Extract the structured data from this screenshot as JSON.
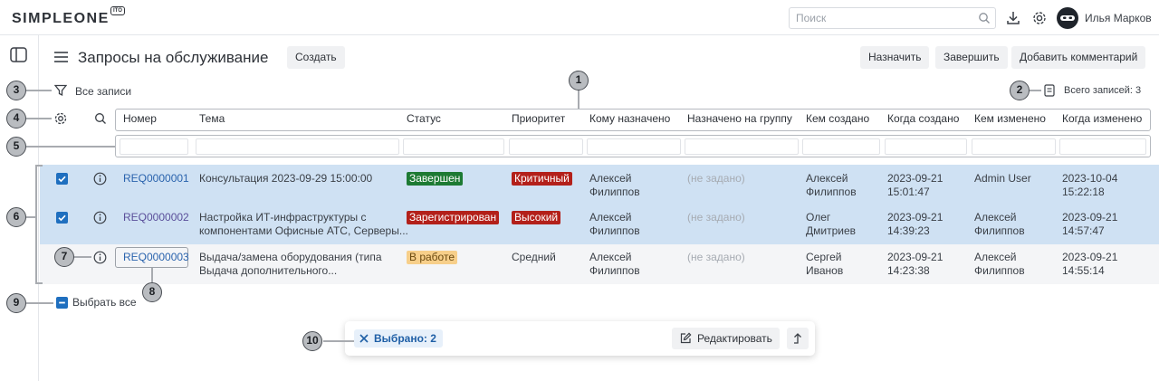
{
  "app": {
    "logo": "SIMPLEONE",
    "logo_badge": "ITO"
  },
  "topbar": {
    "search_placeholder": "Поиск",
    "user_name": "Илья Марков"
  },
  "page": {
    "title": "Запросы на обслуживание",
    "create_label": "Создать"
  },
  "actions": {
    "assign": "Назначить",
    "complete": "Завершить",
    "add_comment": "Добавить комментарий"
  },
  "filter": {
    "label": "Все записи"
  },
  "total": {
    "label": "Всего записей: 3"
  },
  "columns": [
    "Номер",
    "Тема",
    "Статус",
    "Приоритет",
    "Кому назначено",
    "Назначено на группу",
    "Кем создано",
    "Когда создано",
    "Кем изменено",
    "Когда изменено"
  ],
  "rows": [
    {
      "number": "REQ0000001",
      "subject_1": "Консультация 2023-09-29 15:00:00",
      "subject_2": "",
      "status": "Завершен",
      "priority": "Критичный",
      "assignee_1": "Алексей",
      "assignee_2": "Филиппов",
      "group": "(не задано)",
      "created_by_1": "Алексей",
      "created_by_2": "Филиппов",
      "created_date": "2023-09-21",
      "created_time": "15:01:47",
      "updated_by_1": "Admin User",
      "updated_by_2": "",
      "updated_date": "2023-10-04",
      "updated_time": "15:22:18"
    },
    {
      "number": "REQ0000002",
      "subject_1": "Настройка ИТ-инфраструктуры с",
      "subject_2": "компонентами Офисные АТС, Серверы...",
      "status": "Зарегистрирован",
      "priority": "Высокий",
      "assignee_1": "Алексей",
      "assignee_2": "Филиппов",
      "group": "(не задано)",
      "created_by_1": "Олег",
      "created_by_2": "Дмитриев",
      "created_date": "2023-09-21",
      "created_time": "14:39:23",
      "updated_by_1": "Алексей",
      "updated_by_2": "Филиппов",
      "updated_date": "2023-09-21",
      "updated_time": "14:57:47"
    },
    {
      "number": "REQ0000003",
      "subject_1": "Выдача/замена оборудования (типа",
      "subject_2": "Выдача дополнительного...",
      "status": "В работе",
      "priority": "Средний",
      "assignee_1": "Алексей",
      "assignee_2": "Филиппов",
      "group": "(не задано)",
      "created_by_1": "Сергей",
      "created_by_2": "Иванов",
      "created_date": "2023-09-21",
      "created_time": "14:23:38",
      "updated_by_1": "Алексей",
      "updated_by_2": "Филиппов",
      "updated_date": "2023-09-21",
      "updated_time": "14:55:14"
    }
  ],
  "select_all": {
    "label": "Выбрать все"
  },
  "action_bar": {
    "selected_label": "Выбрано: 2",
    "edit_label": "Редактировать"
  },
  "callouts": [
    "1",
    "2",
    "3",
    "4",
    "5",
    "6",
    "7",
    "8",
    "9",
    "10"
  ],
  "colors": {
    "selected_row": "#cfe1f3",
    "link": "#2a63ad",
    "checkbox": "#1f6fbf"
  }
}
